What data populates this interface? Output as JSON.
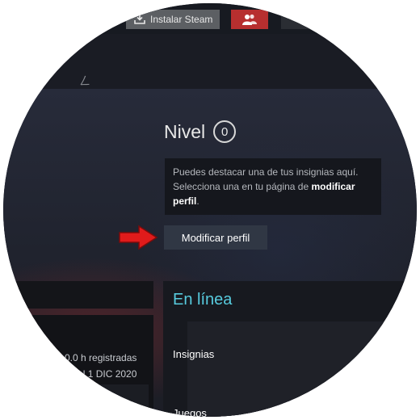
{
  "topbar": {
    "install_label": "Instalar Steam",
    "install_icon": "download-icon",
    "friends_icon": "friends-icon",
    "friends_color": "#b72f2f"
  },
  "header": {
    "mark": "ㄥ"
  },
  "profile": {
    "level_label": "Nivel",
    "level_value": "0",
    "info_text_1": "Puedes destacar una de tus insignias aquí. Selecciona una en tu página de",
    "info_text_bold": "modificar perfil",
    "info_text_end": ".",
    "edit_button_label": "Modificar perfil",
    "arrow_color": "#e01b1b"
  },
  "left": {
    "hours_text": "0.0 h registradas",
    "date_text": "l 1 DIC 2020"
  },
  "right": {
    "status": "En línea",
    "status_color": "#57cbde",
    "badges_label": "Insignias",
    "games_label": "Juegos"
  }
}
